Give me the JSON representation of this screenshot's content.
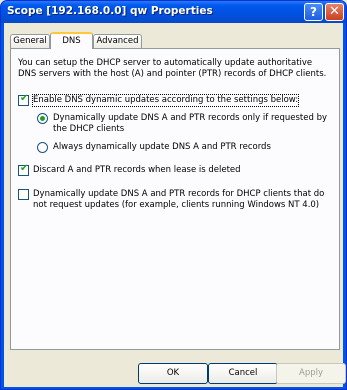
{
  "window": {
    "title": "Scope [192.168.0.0] qw Properties"
  },
  "titlebar_buttons": {
    "help": "?",
    "close": "✕"
  },
  "tabs": [
    {
      "label": "General"
    },
    {
      "label": "DNS"
    },
    {
      "label": "Advanced"
    }
  ],
  "dns": {
    "intro": "You can setup the DHCP server to automatically update authoritative DNS servers with the host (A) and pointer (PTR) records of DHCP clients.",
    "enable_updates": {
      "label": "Enable DNS dynamic updates according to the settings below:",
      "checked": true
    },
    "radio_on_request": {
      "label": "Dynamically update DNS A and PTR records only if requested by the DHCP clients",
      "selected": true
    },
    "radio_always": {
      "label": "Always dynamically update DNS A and PTR records",
      "selected": false
    },
    "discard_records": {
      "label": "Discard A and PTR records when lease is deleted",
      "checked": true
    },
    "update_non_requesting": {
      "label": "Dynamically update DNS A and PTR records for DHCP clients that do not request updates (for example, clients running Windows NT 4.0)",
      "checked": false
    }
  },
  "buttons": {
    "ok": "OK",
    "cancel": "Cancel",
    "apply": "Apply"
  }
}
